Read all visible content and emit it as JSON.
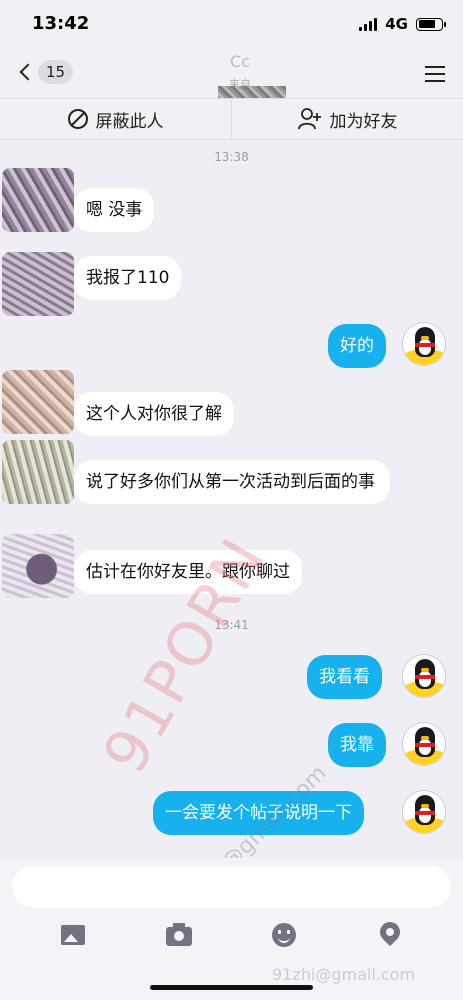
{
  "status_bar": {
    "time": "13:42",
    "network": "4G"
  },
  "header": {
    "back_count": "15",
    "title": "Cc",
    "subtitle": "来自"
  },
  "actions": {
    "block_label": "屏蔽此人",
    "add_friend_label": "加为好友"
  },
  "chat": {
    "timestamps": [
      "13:38",
      "13:41"
    ],
    "messages": [
      {
        "side": "incoming",
        "text": "嗯 没事"
      },
      {
        "side": "incoming",
        "text": "我报了110"
      },
      {
        "side": "outgoing",
        "text": "好的"
      },
      {
        "side": "incoming",
        "text": "这个人对你很了解"
      },
      {
        "side": "incoming",
        "text": "说了好多你们从第一次活动到后面的事"
      },
      {
        "side": "incoming",
        "text": "估计在你好友里。跟你聊过"
      },
      {
        "side": "outgoing",
        "text": "我看看"
      },
      {
        "side": "outgoing",
        "text": "我靠"
      },
      {
        "side": "outgoing",
        "text": "一会要发个帖子说明一下"
      }
    ]
  },
  "watermarks": {
    "main": "91PORN",
    "email": "91zhi@gmail.com",
    "email_bottom": "91zhi@gmail.com"
  },
  "input": {
    "placeholder": ""
  },
  "toolbar_icons": [
    "photo-icon",
    "camera-icon",
    "emoji-icon",
    "location-pin-icon"
  ],
  "colors": {
    "outgoing_bubble": "#17b2ee",
    "incoming_bubble": "#ffffff",
    "background": "#eeeef4"
  }
}
